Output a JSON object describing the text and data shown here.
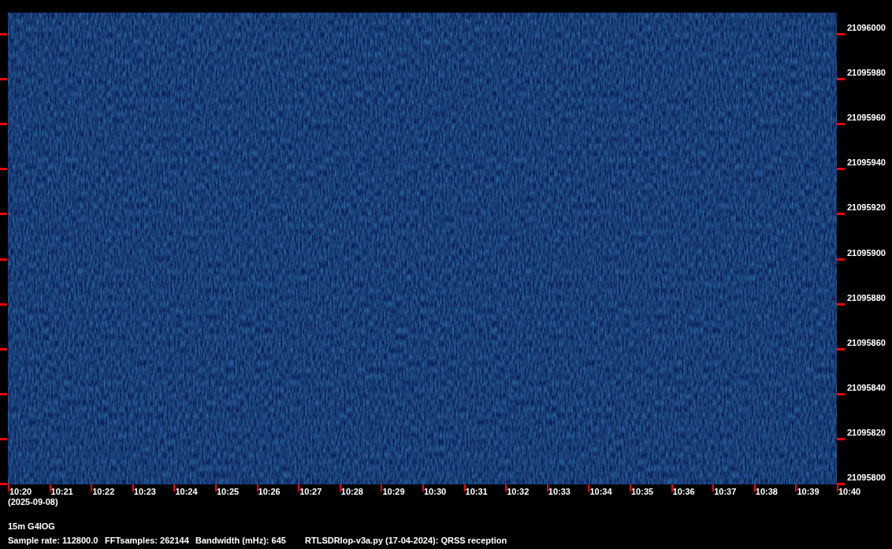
{
  "plot": {
    "frequency_labels": [
      "21096000",
      "21095980",
      "21095960",
      "21095940",
      "21095920",
      "21095900",
      "21095880",
      "21095860",
      "21095840",
      "21095820",
      "21095800"
    ],
    "time_labels": [
      "10:20",
      "10:21",
      "10:22",
      "10:23",
      "10:24",
      "10:25",
      "10:26",
      "10:27",
      "10:28",
      "10:29",
      "10:30",
      "10:31",
      "10:32",
      "10:33",
      "10:34",
      "10:35",
      "10:36",
      "10:37",
      "10:38",
      "10:39",
      "10:40"
    ],
    "date": "(2025-09-08)"
  },
  "footer": {
    "title": "15m G4IOG",
    "sample_rate": "Sample rate: 112800.0",
    "fft_samples": "FFTsamples: 262144",
    "bandwidth": "Bandwidth (mHz): 645",
    "program": "RTLSDRlop-v3a.py (17-04-2024): QRSS reception"
  }
}
